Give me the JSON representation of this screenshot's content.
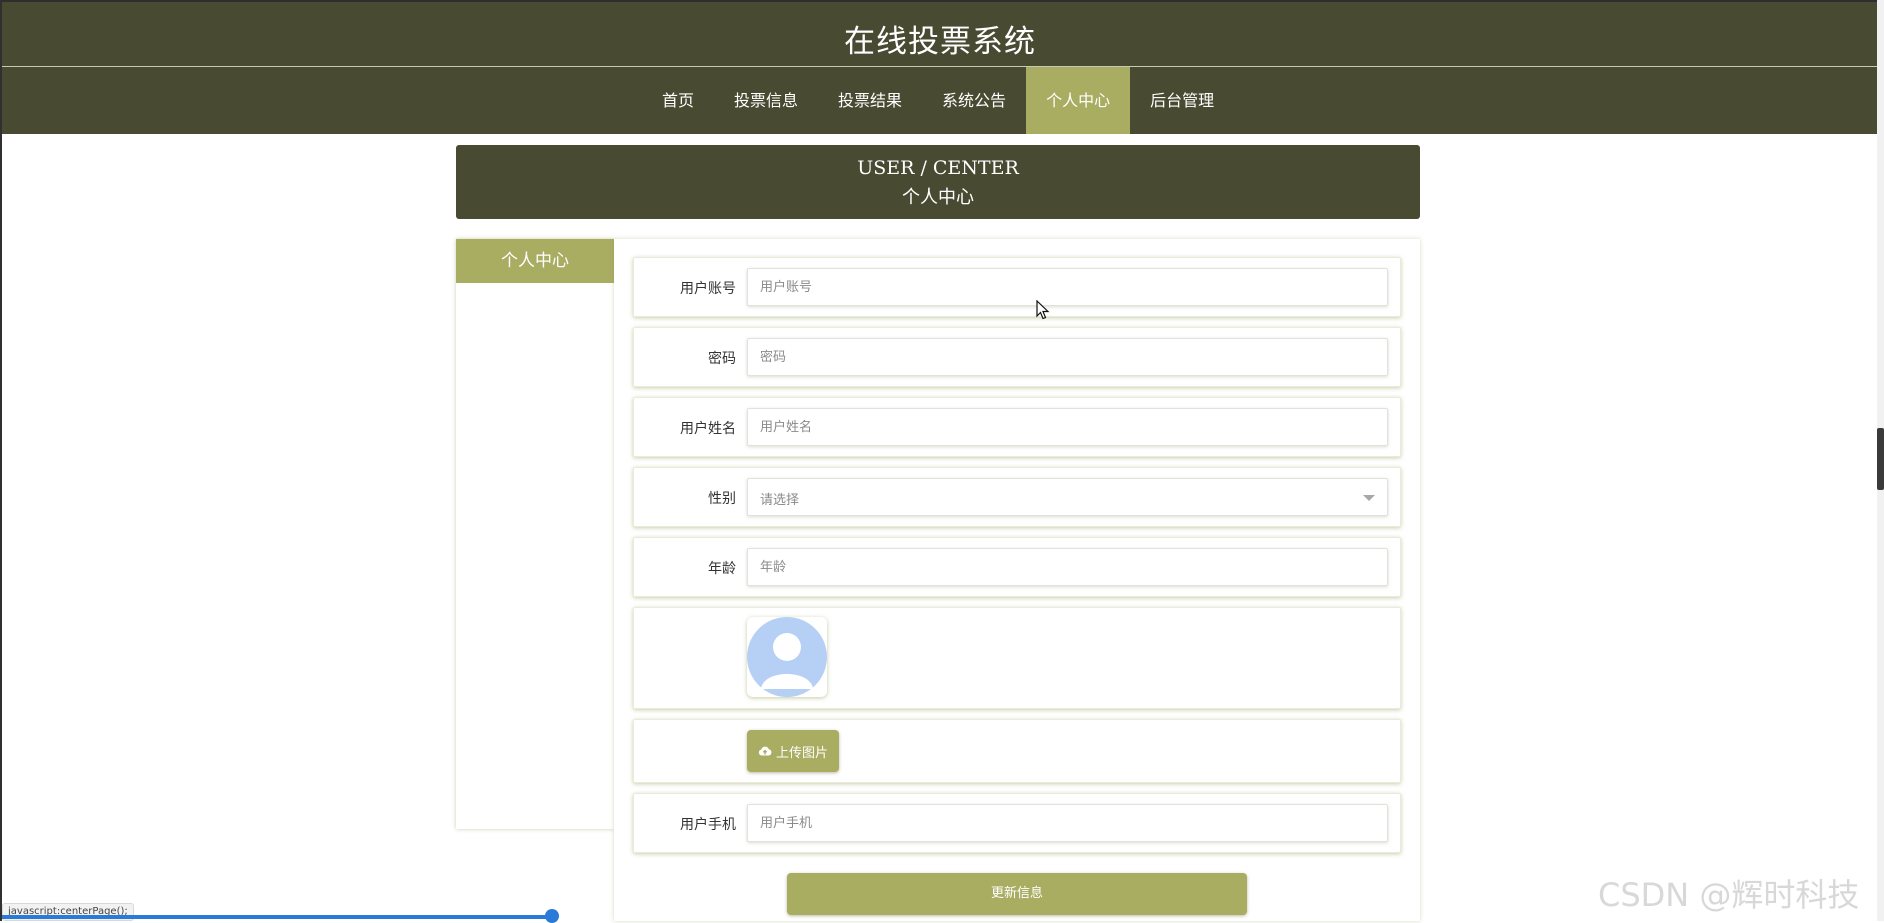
{
  "site": {
    "title": "在线投票系统"
  },
  "nav": {
    "items": [
      {
        "label": "首页",
        "active": false
      },
      {
        "label": "投票信息",
        "active": false
      },
      {
        "label": "投票结果",
        "active": false
      },
      {
        "label": "系统公告",
        "active": false
      },
      {
        "label": "个人中心",
        "active": true
      },
      {
        "label": "后台管理",
        "active": false
      }
    ]
  },
  "banner": {
    "title_en": "USER / CENTER",
    "title_cn": "个人中心"
  },
  "sidebar": {
    "heading": "个人中心"
  },
  "form": {
    "account": {
      "label": "用户账号",
      "placeholder": "用户账号"
    },
    "password": {
      "label": "密码",
      "placeholder": "密码"
    },
    "name": {
      "label": "用户姓名",
      "placeholder": "用户姓名"
    },
    "gender": {
      "label": "性别",
      "value": "请选择"
    },
    "age": {
      "label": "年龄",
      "placeholder": "年龄"
    },
    "upload_label": "上传图片",
    "phone": {
      "label": "用户手机",
      "placeholder": "用户手机"
    },
    "submit_label": "更新信息"
  },
  "status_bar": {
    "url": "javascript:centerPage();"
  },
  "watermark": "CSDN @辉时科技",
  "colors": {
    "header": "#484a32",
    "accent": "#a9ad62",
    "avatar": "#b6cff5"
  }
}
